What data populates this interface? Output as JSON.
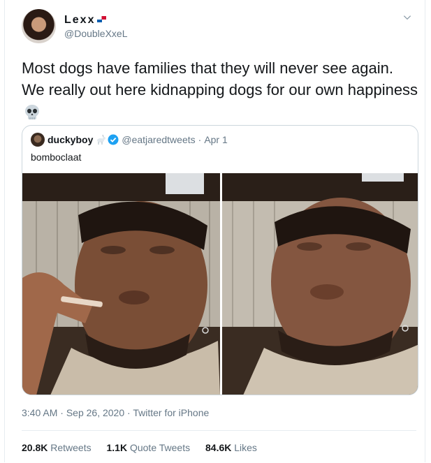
{
  "author": {
    "name": "Lexx",
    "handle": "@DoubleXxeL",
    "avatar_icon": "profile-avatar",
    "flag_icon": "panama-flag-icon"
  },
  "tweet": {
    "text": "Most dogs have families that they will never see again. We really out here kidnapping dogs for our own happiness",
    "emoji": "skull-emoji"
  },
  "quoted": {
    "name": "duckyboy",
    "handle": "@eatjaredtweets",
    "separator": "·",
    "date": "Apr 1",
    "text": "bomboclaat",
    "images": [
      "photo-man-smoking",
      "photo-man-crying"
    ]
  },
  "meta": {
    "time": "3:40 AM",
    "separator": "·",
    "date": "Sep 26, 2020",
    "source": "Twitter for iPhone"
  },
  "stats": {
    "retweets_count": "20.8K",
    "retweets_label": "Retweets",
    "quotes_count": "1.1K",
    "quotes_label": "Quote Tweets",
    "likes_count": "84.6K",
    "likes_label": "Likes"
  },
  "colors": {
    "accent": "#1da1f2",
    "secondary_text": "#657786",
    "border": "#ccd6dd"
  }
}
